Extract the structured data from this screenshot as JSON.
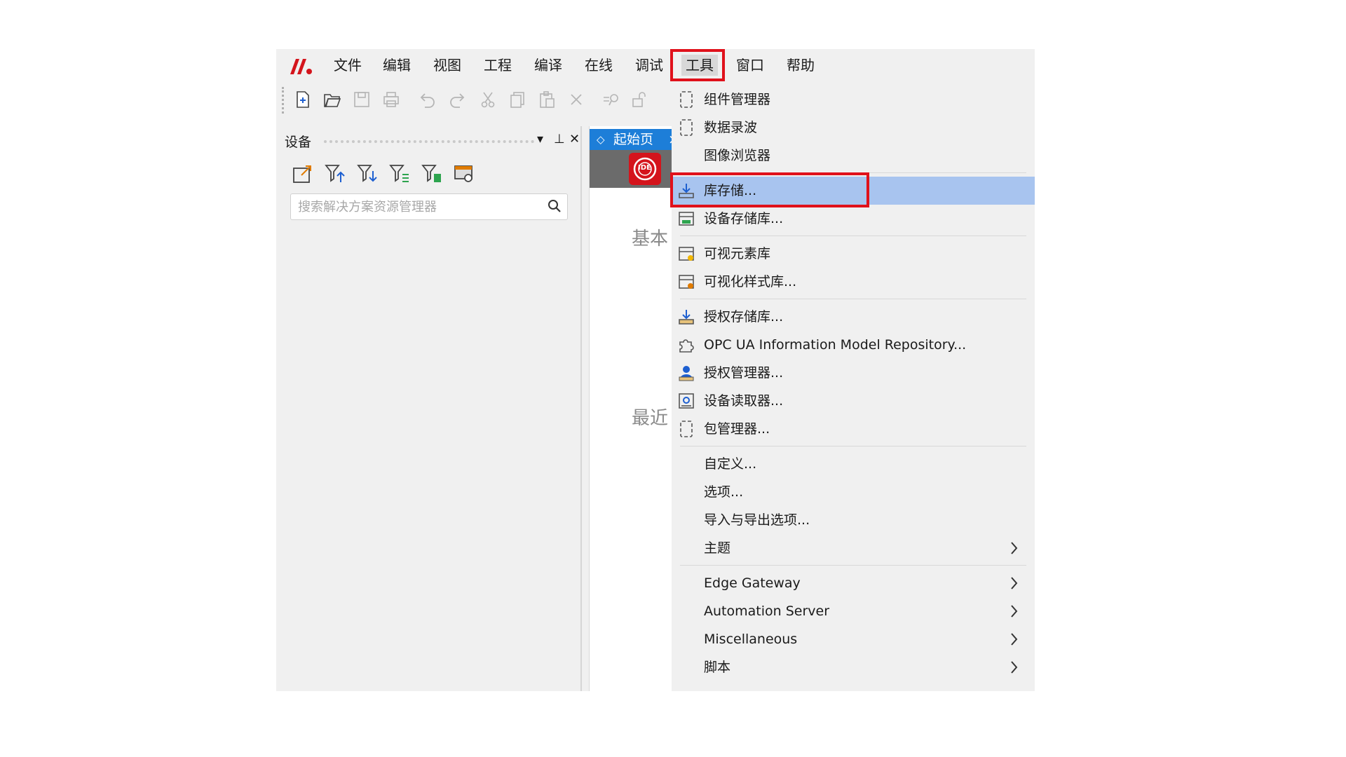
{
  "app": {
    "menu": [
      "文件",
      "编辑",
      "视图",
      "工程",
      "编译",
      "在线",
      "调试",
      "工具",
      "窗口",
      "帮助"
    ],
    "active_menu": "工具"
  },
  "toolbar": {
    "icons": [
      "new-file-icon",
      "open-folder-icon",
      "save-icon",
      "print-icon",
      "undo-icon",
      "redo-icon",
      "cut-icon",
      "copy-icon",
      "paste-icon",
      "delete-icon",
      "find-icon",
      "unlock-icon"
    ]
  },
  "device_panel": {
    "title": "设备",
    "controls": [
      "▾",
      "⊥",
      "✕"
    ],
    "search_placeholder": "搜索解决方案资源管理器"
  },
  "start_page": {
    "tab_label": "起始页",
    "tab_close": "×",
    "logo_text": "IDE",
    "heading_basic": "基本",
    "heading_recent": "最近"
  },
  "tools_menu": {
    "items": [
      {
        "label": "组件管理器",
        "icon": "component-manager-icon",
        "submenu": false
      },
      {
        "label": "数据录波",
        "icon": "data-recording-icon",
        "submenu": false
      },
      {
        "label": "图像浏览器",
        "icon": "",
        "submenu": false
      },
      {
        "label": "库存储...",
        "icon": "download-tray-icon",
        "submenu": false,
        "highlighted": true
      },
      {
        "label": "设备存储库...",
        "icon": "device-repository-icon",
        "submenu": false
      },
      {
        "label": "可视元素库",
        "icon": "visual-element-library-icon",
        "submenu": false
      },
      {
        "label": "可视化样式库...",
        "icon": "visual-style-library-icon",
        "submenu": false
      },
      {
        "label": "授权存储库...",
        "icon": "license-repository-icon",
        "submenu": false
      },
      {
        "label": "OPC UA Information Model Repository...",
        "icon": "puzzle-icon",
        "submenu": false
      },
      {
        "label": "授权管理器...",
        "icon": "license-manager-icon",
        "submenu": false
      },
      {
        "label": "设备读取器...",
        "icon": "device-reader-icon",
        "submenu": false
      },
      {
        "label": "包管理器...",
        "icon": "package-manager-icon",
        "submenu": false
      },
      {
        "label": "自定义...",
        "icon": "",
        "submenu": false
      },
      {
        "label": "选项...",
        "icon": "",
        "submenu": false
      },
      {
        "label": "导入与导出选项...",
        "icon": "",
        "submenu": false
      },
      {
        "label": "主题",
        "icon": "",
        "submenu": true
      },
      {
        "label": "Edge Gateway",
        "icon": "",
        "submenu": true
      },
      {
        "label": "Automation Server",
        "icon": "",
        "submenu": true
      },
      {
        "label": "Miscellaneous",
        "icon": "",
        "submenu": true
      },
      {
        "label": "脚本",
        "icon": "",
        "submenu": true
      }
    ]
  },
  "colors": {
    "highlight": "#a8c4ef",
    "annotation_red": "#e0111b",
    "tab_blue": "#1d7ed8",
    "logo_red": "#d4141c"
  }
}
